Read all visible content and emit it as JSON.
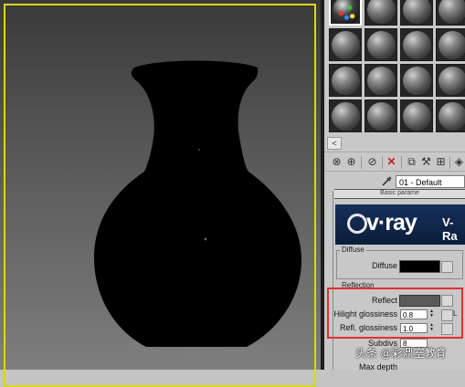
{
  "material_editor": {
    "active_material": "01 - Default",
    "scroll_left_glyph": "<",
    "rollout_title": "Basic parame",
    "banner_logo": "v·ray",
    "banner_right": "V-Ra",
    "diffuse": {
      "group_title": "Diffuse",
      "label": "Diffuse",
      "color": "#000000"
    },
    "reflection": {
      "group_title": "Reflection",
      "reflect_label": "Reflect",
      "reflect_color": "#5a5a5a",
      "hilight_label": "Hilight glossiness",
      "hilight_value": "0.8",
      "lock_label": "L",
      "refl_label": "Refl. glossiness",
      "refl_value": "1.0",
      "subdivs_label": "Subdivs",
      "subdivs_value": "8",
      "max_depth_label": "Max depth"
    }
  },
  "icons": [
    "put-to-scene-icon",
    "assign-icon",
    "reset-icon",
    "delete-icon",
    "copy-icon",
    "unique-icon",
    "put-to-library-icon",
    "material-effects-icon",
    "eyedropper-icon"
  ],
  "toolbar_glyphs": [
    "⊗",
    "⊕",
    "⊘",
    "✕",
    "⧉",
    "⚒",
    "⊞",
    "◈"
  ],
  "watermark": "头条 @彩鼎室教育",
  "colors": {
    "highlight_box": "#e03030",
    "viewport_border": "#d8d81a"
  }
}
